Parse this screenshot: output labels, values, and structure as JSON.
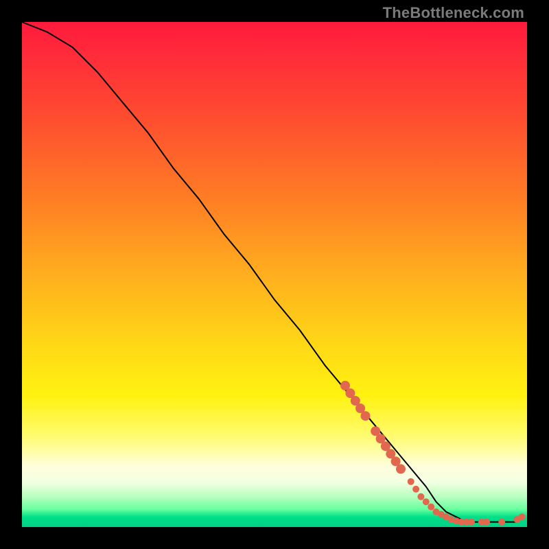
{
  "watermark": "TheBottleneck.com",
  "chart_data": {
    "type": "line",
    "title": "",
    "xlabel": "",
    "ylabel": "",
    "xlim": [
      0,
      100
    ],
    "ylim": [
      0,
      100
    ],
    "grid": false,
    "legend": false,
    "series": [
      {
        "name": "curve",
        "x": [
          0,
          5,
          10,
          15,
          20,
          25,
          30,
          35,
          40,
          45,
          50,
          55,
          60,
          65,
          70,
          75,
          80,
          82,
          84,
          86,
          88,
          90,
          92,
          94,
          96,
          98,
          99
        ],
        "y": [
          100,
          98,
          95,
          90,
          84,
          78,
          71,
          65,
          58,
          52,
          45,
          39,
          32,
          26,
          20,
          14,
          8,
          5,
          3,
          2,
          1,
          1,
          1,
          1,
          1,
          1,
          2
        ],
        "color": "#000000"
      }
    ],
    "markers": [
      {
        "x": 64,
        "y": 28
      },
      {
        "x": 65,
        "y": 26.5
      },
      {
        "x": 66,
        "y": 25
      },
      {
        "x": 67,
        "y": 23.5
      },
      {
        "x": 68,
        "y": 22
      },
      {
        "x": 70,
        "y": 19
      },
      {
        "x": 71,
        "y": 17.5
      },
      {
        "x": 72,
        "y": 16
      },
      {
        "x": 73,
        "y": 14.5
      },
      {
        "x": 74,
        "y": 13
      },
      {
        "x": 75,
        "y": 11.5
      },
      {
        "x": 77,
        "y": 9
      },
      {
        "x": 78,
        "y": 7.5
      },
      {
        "x": 79,
        "y": 6
      },
      {
        "x": 80,
        "y": 5
      },
      {
        "x": 81,
        "y": 4
      },
      {
        "x": 82,
        "y": 3
      },
      {
        "x": 83,
        "y": 2.5
      },
      {
        "x": 84,
        "y": 2
      },
      {
        "x": 85,
        "y": 1.5
      },
      {
        "x": 86,
        "y": 1.2
      },
      {
        "x": 87,
        "y": 1
      },
      {
        "x": 88,
        "y": 1
      },
      {
        "x": 89,
        "y": 1
      },
      {
        "x": 91,
        "y": 1
      },
      {
        "x": 92,
        "y": 1
      },
      {
        "x": 95,
        "y": 1
      },
      {
        "x": 98,
        "y": 1.5
      },
      {
        "x": 99,
        "y": 2
      }
    ],
    "marker_color": "#e2674f",
    "marker_radius_small": 5,
    "marker_radius_large": 7
  }
}
